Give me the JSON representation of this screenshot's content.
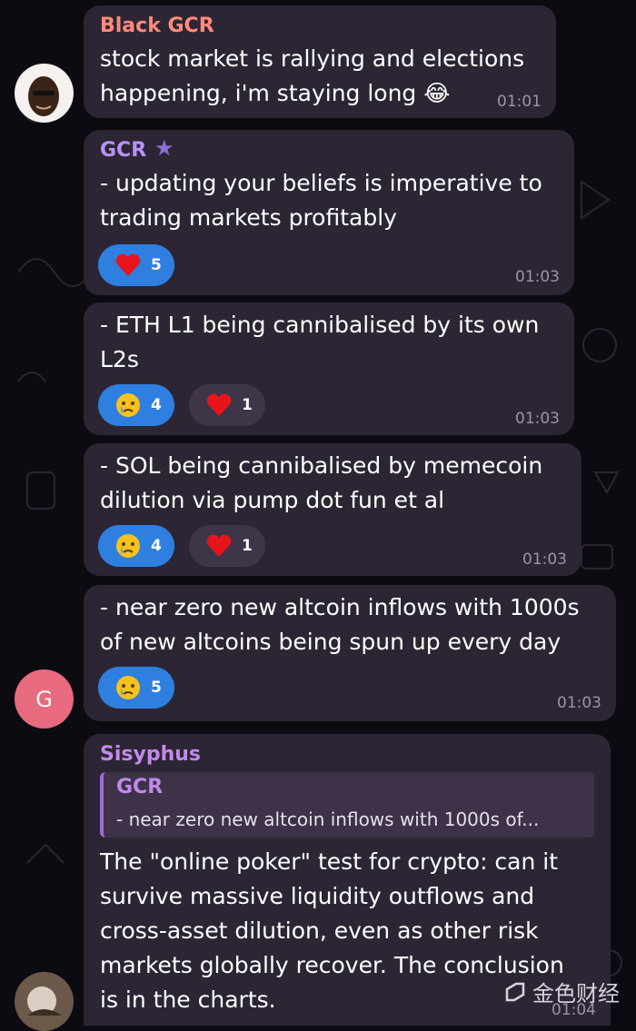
{
  "messages": [
    {
      "sender": "Black GCR",
      "sender_color": "#ff8a7a",
      "lines": [
        "stock market is rallying and elections",
        "happening, i'm staying long 😂"
      ],
      "time": "01:01"
    },
    {
      "sender": "GCR",
      "sender_color": "#b892ff",
      "lines": [
        "- updating your beliefs is imperative to",
        "trading markets profitably"
      ],
      "reactions": [
        {
          "emoji": "heart-icon",
          "count": "5",
          "style": "blue"
        }
      ],
      "time": "01:03"
    },
    {
      "lines": [
        "- ETH L1 being cannibalised by its own",
        "L2s"
      ],
      "reactions": [
        {
          "emoji": "crying-face-icon",
          "count": "4",
          "style": "blue"
        },
        {
          "emoji": "heart-icon",
          "count": "1",
          "style": "dark"
        }
      ],
      "time": "01:03"
    },
    {
      "lines": [
        "- SOL being cannibalised by memecoin",
        "dilution via pump dot fun et al"
      ],
      "reactions": [
        {
          "emoji": "crying-face-icon",
          "count": "4",
          "style": "blue"
        },
        {
          "emoji": "heart-icon",
          "count": "1",
          "style": "dark"
        }
      ],
      "time": "01:03"
    },
    {
      "lines": [
        "- near zero new altcoin inflows with 1000s",
        "of new altcoins being spun up every day"
      ],
      "reactions": [
        {
          "emoji": "crying-face-icon",
          "count": "5",
          "style": "blue"
        }
      ],
      "time": "01:03"
    },
    {
      "sender": "Sisyphus",
      "sender_color": "#c28ae8",
      "quote": {
        "name": "GCR",
        "text": "- near zero new altcoin inflows with 1000s of..."
      },
      "lines": [
        "The \"online poker\" test for crypto: can it",
        "survive massive liquidity outflows and",
        "cross-asset dilution, even as other risk",
        "markets globally recover. The conclusion",
        "is in the charts."
      ],
      "time": "01:04"
    }
  ],
  "avatars": {
    "gcr_letter": "G",
    "gcr_color": "#e86a7e"
  },
  "watermark": "金色财经",
  "colors": {
    "bubble": "#2c2634",
    "reaction_blue": "#2f7fe0",
    "background": "#0d0b12"
  }
}
